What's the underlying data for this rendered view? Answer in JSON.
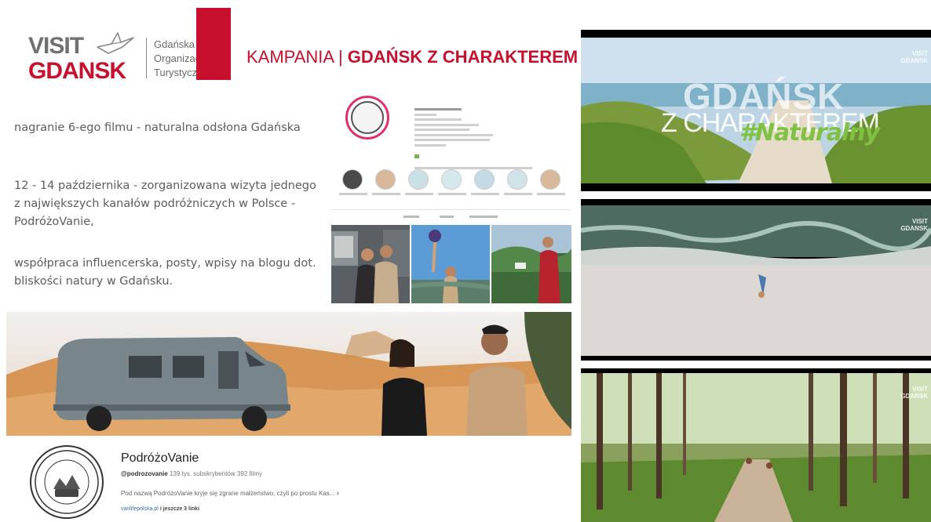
{
  "logo": {
    "visit": "VISIT",
    "gdansk": "GDANSK",
    "org_line1": "Gdańska",
    "org_line2": "Organizacja",
    "org_line3": "Turystyczna"
  },
  "campaign": {
    "prefix": "KAMPANIA | ",
    "title": "GDAŃSK Z CHARAKTEREM"
  },
  "bullets": [
    "nagranie 6-ego filmu - naturalna odsłona Gdańska",
    "12 - 14 października - zorganizowana wizyta jednego z największych kanałów podróżniczych w Polsce - PodróżoVanie,",
    "współpraca influencerska, posty, wpisy na blogu dot. bliskości natury w Gdańsku."
  ],
  "youtube": {
    "channel_name": "PodróżoVanie",
    "handle": "@podrozovanie",
    "stats": "139 tys. subskrybentów  392 filmy",
    "description": "Pod nazwą PodróżoVanie kryje się zgrane małżeństwo, czyli po prostu Kas...",
    "link": "vanlifepolska.pl",
    "more_links": " i jeszcze 3 linki",
    "logo_text_top": "PODRÓŻOVANIE",
    "logo_text_bottom": "VAN LIFE POLSKA"
  },
  "frames": {
    "watermark_line1": "VISIT",
    "watermark_line2": "GDANSK",
    "frame1_title": "GDAŃSK",
    "frame1_subtitle": "Z CHARAKTEREM",
    "frame1_hashtag": "#Naturalny"
  },
  "colors": {
    "brand_red": "#c8102e",
    "hashtag_green": "#7fc241"
  }
}
